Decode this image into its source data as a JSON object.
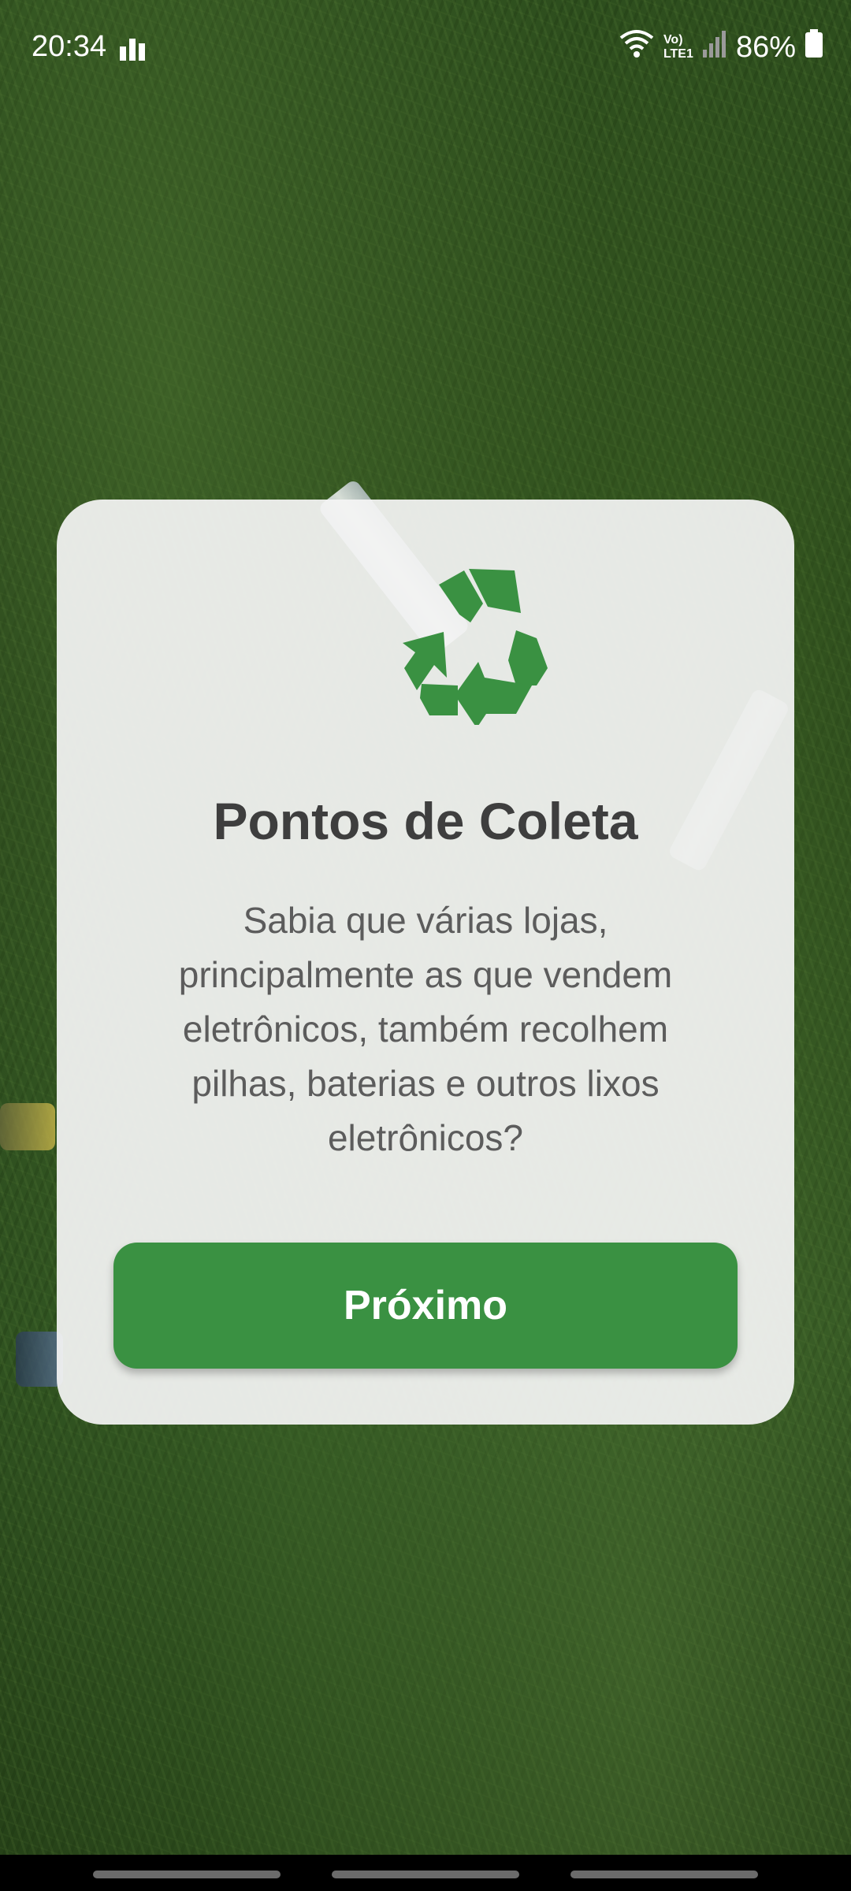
{
  "status_bar": {
    "time": "20:34",
    "battery": "86%",
    "network_label": "Vo) LTE1"
  },
  "card": {
    "icon": "recycle-icon",
    "title": "Pontos de Coleta",
    "description": "Sabia que várias lojas, principalmente as que vendem eletrônicos, também recolhem pilhas, baterias e outros lixos eletrônicos?",
    "button_label": "Próximo"
  },
  "colors": {
    "accent": "#3a9142",
    "card_bg": "#f4f4f4",
    "title": "#3e3e3e",
    "text": "#5c5c5c"
  }
}
